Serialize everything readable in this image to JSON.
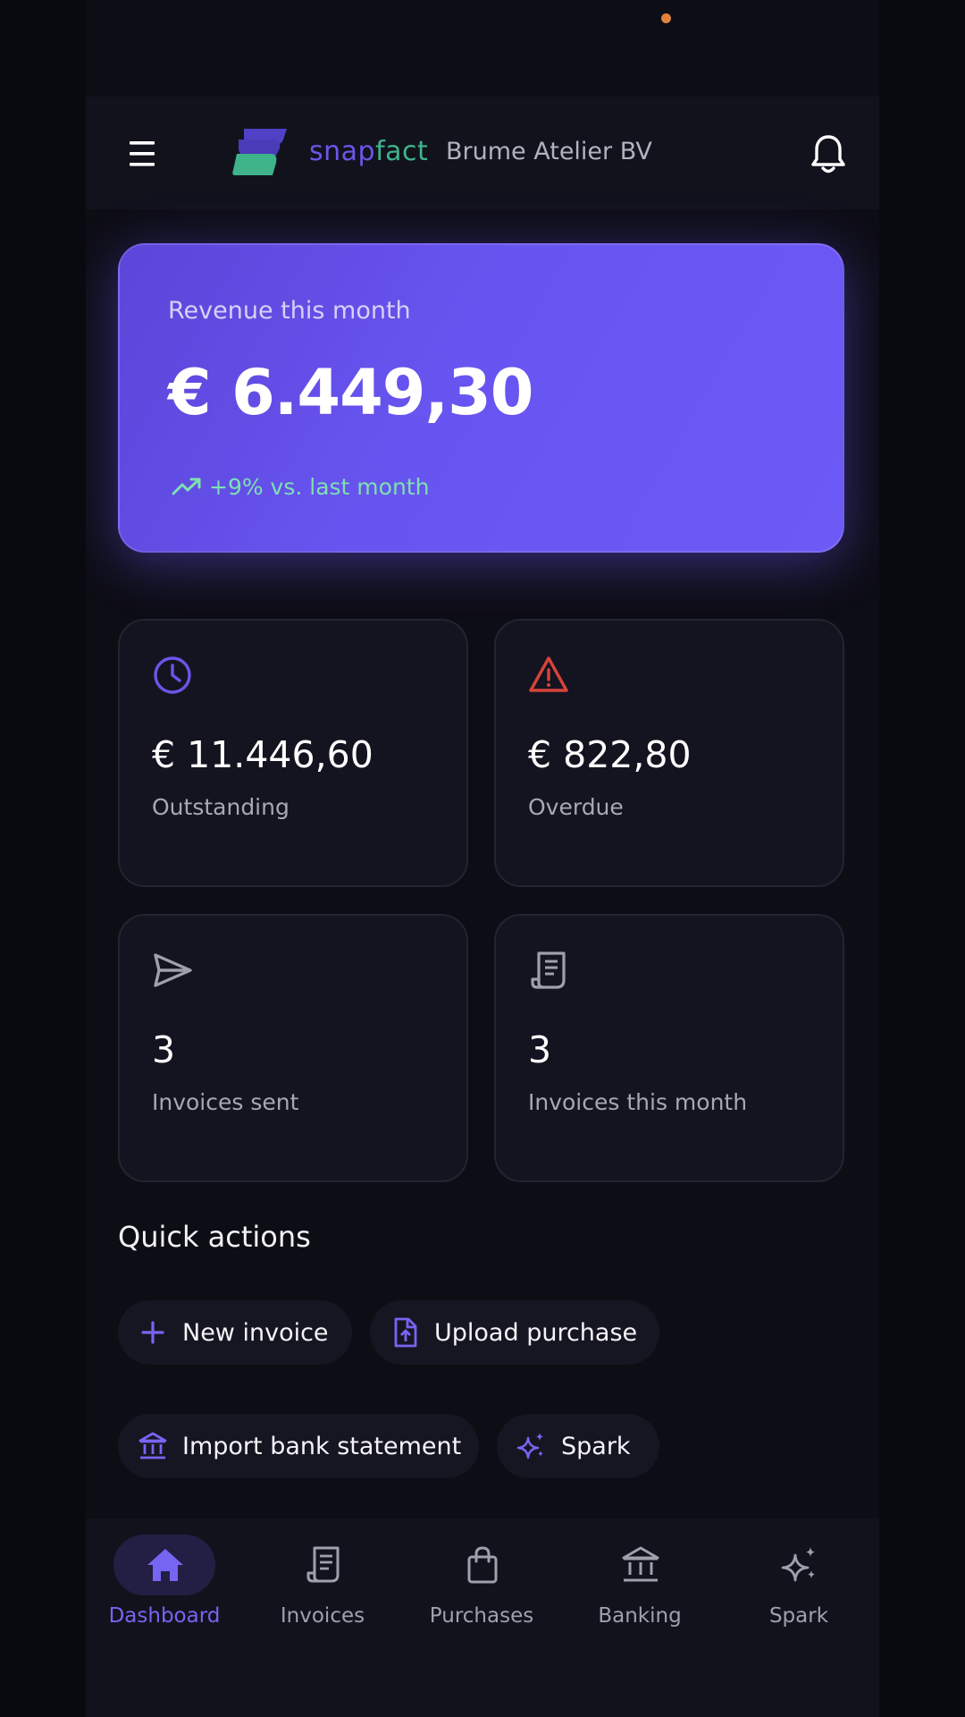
{
  "header": {
    "brand_part1": "snap",
    "brand_part2": "fact",
    "company": "Brume Atelier BV",
    "icons": {
      "menu": "menu-icon",
      "logo": "snapfact-logo",
      "notifications": "bell-icon"
    }
  },
  "revenue": {
    "label": "Revenue this month",
    "value": "€ 6.449,30",
    "trend": "+9% vs. last month",
    "trend_icon": "trending-up-icon"
  },
  "stats": [
    {
      "value": "€ 11.446,60",
      "label": "Outstanding",
      "icon": "clock-icon",
      "color": "#6a56e8"
    },
    {
      "value": "€ 822,80",
      "label": "Overdue",
      "icon": "warning-icon",
      "color": "#d7443b"
    },
    {
      "value": "3",
      "label": "Invoices sent",
      "icon": "send-icon",
      "color": "#9ea0ad"
    },
    {
      "value": "3",
      "label": "Invoices this month",
      "icon": "receipt-icon",
      "color": "#9ea0ad"
    }
  ],
  "quick_actions": {
    "title": "Quick actions",
    "items": [
      {
        "label": "New invoice",
        "icon": "plus-icon"
      },
      {
        "label": "Upload purchase",
        "icon": "file-upload-icon"
      },
      {
        "label": "Import bank statement",
        "icon": "bank-icon"
      },
      {
        "label": "Spark",
        "icon": "sparkle-icon"
      }
    ]
  },
  "nav": {
    "items": [
      {
        "label": "Dashboard",
        "icon": "home-icon",
        "active": true
      },
      {
        "label": "Invoices",
        "icon": "receipt-icon",
        "active": false
      },
      {
        "label": "Purchases",
        "icon": "shopping-bag-icon",
        "active": false
      },
      {
        "label": "Banking",
        "icon": "bank-icon",
        "active": false
      },
      {
        "label": "Spark",
        "icon": "sparkle-icon",
        "active": false
      }
    ]
  },
  "colors": {
    "accent": "#6a56e8",
    "brand_green": "#3fb38a",
    "danger": "#d7443b",
    "positive": "#7ee0b2",
    "background": "#0d0d15"
  }
}
